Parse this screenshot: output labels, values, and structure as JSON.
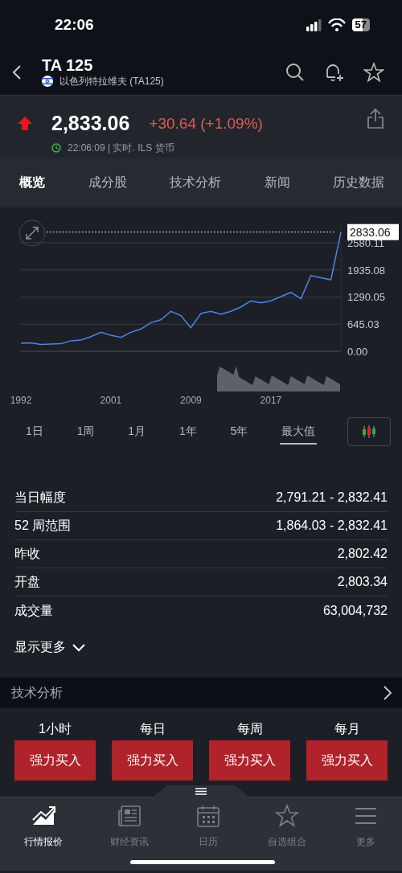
{
  "status_bar": {
    "time": "22:06",
    "battery": "57"
  },
  "header": {
    "title": "TA 125",
    "subtitle": "以色列特拉维夫 (TA125)"
  },
  "quote": {
    "price": "2,833.06",
    "rising": true,
    "change": "+30.64 (+1.09%)",
    "timestamp": "22:06:09 | 实时. ILS 货币"
  },
  "tabs": [
    {
      "label": "概览",
      "selected": true
    },
    {
      "label": "成分股",
      "selected": false
    },
    {
      "label": "技术分析",
      "selected": false
    },
    {
      "label": "新闻",
      "selected": false
    },
    {
      "label": "历史数据",
      "selected": false
    }
  ],
  "chart": {
    "chart_data": {
      "type": "line",
      "grid": true,
      "xlim": [
        1992,
        2024
      ],
      "ylim": [
        0,
        3000
      ],
      "ref_lines": [
        {
          "axis": "y",
          "value": 2833.06,
          "label": "2833.06"
        }
      ],
      "x": [
        1992,
        1993,
        1994,
        1995,
        1996,
        1997,
        1998,
        1999,
        2000,
        2001,
        2002,
        2003,
        2004,
        2005,
        2006,
        2007,
        2008,
        2009,
        2010,
        2011,
        2012,
        2013,
        2014,
        2015,
        2016,
        2017,
        2018,
        2019,
        2020,
        2021,
        2022,
        2023,
        2024
      ],
      "series": [
        {
          "color": "#4a86e8",
          "values": [
            190,
            200,
            160,
            170,
            180,
            250,
            270,
            350,
            450,
            380,
            330,
            450,
            530,
            680,
            750,
            950,
            850,
            560,
            900,
            950,
            880,
            950,
            1050,
            1200,
            1150,
            1200,
            1300,
            1400,
            1250,
            1800,
            1750,
            1700,
            2830
          ]
        }
      ],
      "xticks": [
        1992,
        2001,
        2009,
        2017
      ],
      "yticks": [
        {
          "value": 0,
          "label": "0.00"
        },
        {
          "value": 645.03,
          "label": "645.03"
        },
        {
          "value": 1290.05,
          "label": "1290.05"
        },
        {
          "value": 1935.08,
          "label": "1935.08"
        },
        {
          "value": 2580.11,
          "label": "2580.11"
        }
      ]
    }
  },
  "ranges": [
    {
      "label": "1日",
      "selected": false
    },
    {
      "label": "1周",
      "selected": false
    },
    {
      "label": "1月",
      "selected": false
    },
    {
      "label": "1年",
      "selected": false
    },
    {
      "label": "5年",
      "selected": false
    },
    {
      "label": "最大值",
      "selected": true
    }
  ],
  "stats": [
    {
      "label": "当日幅度",
      "value": "2,791.21 - 2,832.41"
    },
    {
      "label": "52 周范围",
      "value": "1,864.03 - 2,832.41"
    },
    {
      "label": "昨收",
      "value": "2,802.42"
    },
    {
      "label": "开盘",
      "value": "2,803.34"
    },
    {
      "label": "成交量",
      "value": "63,004,732"
    }
  ],
  "show_more": "显示更多",
  "technical": {
    "title": "技术分析",
    "periods": [
      {
        "label": "1小时",
        "signal": "强力买入"
      },
      {
        "label": "每日",
        "signal": "强力买入"
      },
      {
        "label": "每周",
        "signal": "强力买入"
      },
      {
        "label": "每月",
        "signal": "强力买入"
      }
    ]
  },
  "bottom_nav": [
    {
      "label": "行情报价",
      "selected": true
    },
    {
      "label": "财经资讯",
      "selected": false
    },
    {
      "label": "日历",
      "selected": false
    },
    {
      "label": "自选组合",
      "selected": false
    },
    {
      "label": "更多",
      "selected": false
    }
  ]
}
